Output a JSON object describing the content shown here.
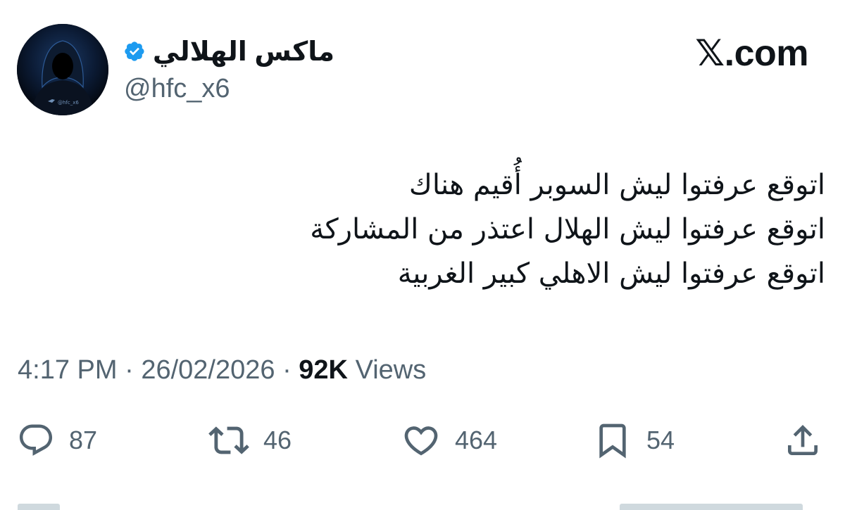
{
  "author": {
    "display_name": "ماكس الهلالي",
    "handle": "@hfc_x6",
    "verified": true,
    "avatar_icon": "hooded-figure-avatar",
    "avatar_caption": "@hfc_x6"
  },
  "brand": {
    "label": "𝕏.com"
  },
  "tweet": {
    "lines": [
      "اتوقع عرفتوا ليش السوبر أُقيم هناك",
      "اتوقع عرفتوا ليش الهلال اعتذر من المشاركة",
      "اتوقع عرفتوا ليش الاهلي كبير الغربية"
    ]
  },
  "meta": {
    "time": "4:17 PM",
    "separator": "·",
    "date": "26/02/2026",
    "views_count": "92K",
    "views_label": "Views"
  },
  "actions": {
    "reply": {
      "icon": "reply-icon",
      "count": "87"
    },
    "repost": {
      "icon": "repost-icon",
      "count": "46"
    },
    "like": {
      "icon": "heart-icon",
      "count": "464"
    },
    "bookmark": {
      "icon": "bookmark-icon",
      "count": "54"
    },
    "share": {
      "icon": "share-icon"
    }
  },
  "colors": {
    "text_primary": "#0f1419",
    "text_secondary": "#536471",
    "verified_blue": "#1d9bf0",
    "background": "#ffffff"
  }
}
